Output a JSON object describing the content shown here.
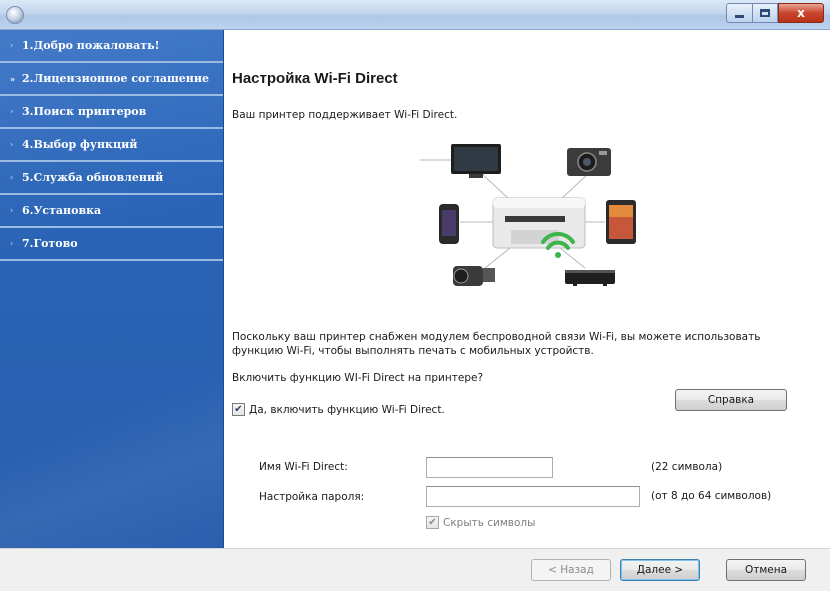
{
  "window": {
    "controls": {
      "minimize_icon": "minimize-icon",
      "maximize_icon": "maximize-icon",
      "close_icon": "close-icon",
      "close_glyph": "x"
    }
  },
  "sidebar": {
    "steps": [
      {
        "label": "1.Добро пожаловать!",
        "active": false
      },
      {
        "label": "2.Лицензионное соглашение",
        "active": true
      },
      {
        "label": "3.Поиск принтеров",
        "active": false
      },
      {
        "label": "4.Выбор функций",
        "active": false
      },
      {
        "label": "5.Служба обновлений",
        "active": false
      },
      {
        "label": "6.Установка",
        "active": false
      },
      {
        "label": "7.Готово",
        "active": false
      }
    ],
    "inactive_arrow": "›",
    "active_arrow": "»"
  },
  "main": {
    "title": "Настройка Wi-Fi Direct",
    "subtitle": "Ваш принтер поддерживает Wi-Fi Direct.",
    "description": "Поскольку ваш принтер снабжен модулем беспроводной связи Wi-Fi, вы можете использовать функцию Wi-Fi, чтобы выполнять печать с мобильных устройств.",
    "question": "Включить функцию WI-Fi Direct на принтере?",
    "enable_checkbox": {
      "label": "Да, включить функцию Wi-Fi Direct.",
      "checked": true
    },
    "help_button": "Справка",
    "fields": {
      "name_label": "Имя Wi-Fi Direct:",
      "name_value": "",
      "name_hint": "(22 символа)",
      "password_label": "Настройка пароля:",
      "password_value": "",
      "password_hint": "(от 8 до 64 символов)"
    },
    "hide_chars_checkbox": {
      "label": "Скрыть символы",
      "checked": true,
      "disabled": true
    }
  },
  "footer": {
    "back_button": "< Назад",
    "next_button": "Далее >",
    "cancel_button": "Отмена"
  },
  "colors": {
    "sidebar_bg": "#2a63b5",
    "wifi_green": "#3cb54a",
    "title_bar": "#bcd3ee"
  }
}
